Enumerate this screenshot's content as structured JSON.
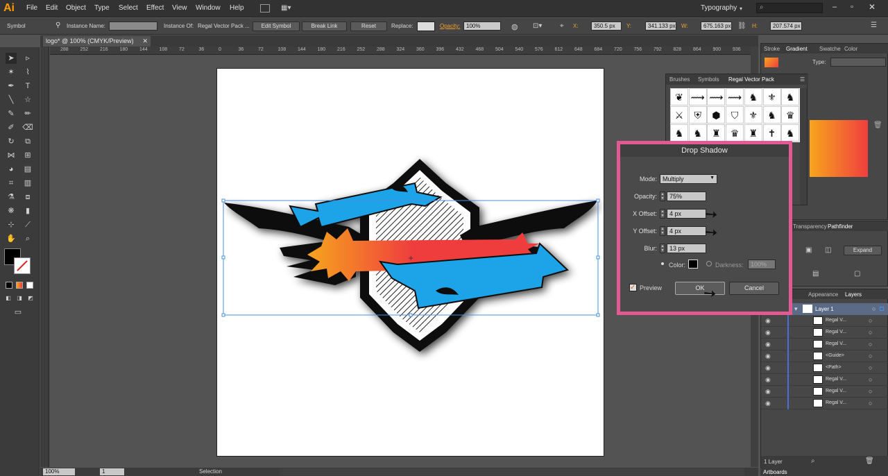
{
  "app": {
    "logo": "Ai",
    "workspace": "Typography"
  },
  "menu": [
    "File",
    "Edit",
    "Object",
    "Type",
    "Select",
    "Effect",
    "View",
    "Window",
    "Help"
  ],
  "control": {
    "selection_type": "Symbol",
    "instance_name_label": "Instance Name:",
    "instance_of_label": "Instance Of:",
    "instance_of_value": "Regal Vector Pack ...",
    "edit_symbol": "Edit Symbol",
    "break_link": "Break Link",
    "reset": "Reset",
    "replace_label": "Replace:",
    "opacity_label": "Opacity:",
    "opacity_value": "100%",
    "x_label": "X:",
    "x_value": "350.5 px",
    "y_label": "Y:",
    "y_value": "341.133 px",
    "w_label": "W:",
    "w_value": "675.163 px",
    "h_label": "H:",
    "h_value": "207.574 px"
  },
  "document": {
    "tab_title": "logo* @ 100% (CMYK/Preview)"
  },
  "ruler_h": [
    "288",
    "252",
    "216",
    "180",
    "144",
    "108",
    "72",
    "36",
    "0",
    "36",
    "72",
    "108",
    "144",
    "180",
    "216",
    "252",
    "288",
    "324",
    "360",
    "396",
    "432",
    "468",
    "504",
    "540",
    "576",
    "612",
    "648",
    "684",
    "720",
    "756",
    "792",
    "828",
    "864",
    "900",
    "936"
  ],
  "ruler_v": [
    "0",
    "3",
    "6",
    "9",
    "1",
    "2",
    "1",
    "6",
    "1",
    "2",
    "2",
    "4",
    "2",
    "6",
    "2",
    "3",
    "3",
    "3",
    "3",
    "5",
    "4",
    "2",
    "4",
    "5",
    "4",
    "8"
  ],
  "gradient_panel": {
    "tabs": [
      "Stroke",
      "Gradient",
      "Swatche",
      "Color"
    ],
    "type_label": "Type:"
  },
  "symbols_panel": {
    "tabs": [
      "Brushes",
      "Symbols",
      "Regal Vector Pack"
    ]
  },
  "pathfinder_panel": {
    "tabs": [
      "Transparency",
      "Pathfinder"
    ],
    "expand": "Expand"
  },
  "layers_panel": {
    "tabs": [
      "Appearance",
      "Layers"
    ],
    "layer_name": "Layer 1",
    "rows": [
      "Regal V...",
      "Regal V...",
      "Regal V...",
      "<Guide>",
      "<Path>",
      "Regal V...",
      "Regal V...",
      "Regal V..."
    ],
    "footer": "1 Layer"
  },
  "drop_shadow": {
    "title": "Drop Shadow",
    "mode_label": "Mode:",
    "mode_value": "Multiply",
    "opacity_label": "Opacity:",
    "opacity_value": "75%",
    "x_label": "X Offset:",
    "x_value": "4 px",
    "y_label": "Y Offset:",
    "y_value": "4 px",
    "blur_label": "Blur:",
    "blur_value": "13 px",
    "color_label": "Color:",
    "darkness_label": "Darkness:",
    "darkness_value": "100%",
    "preview_label": "Preview",
    "ok": "OK",
    "cancel": "Cancel"
  },
  "status": {
    "zoom": "100%",
    "page": "1",
    "tool": "Selection"
  },
  "artboards_tab": "Artboards",
  "colors": {
    "accent_pink": "#e35a92",
    "ribbon_blue": "#1aa3e8",
    "grad_start": "#f7a51e",
    "grad_end": "#ef3e3e"
  }
}
